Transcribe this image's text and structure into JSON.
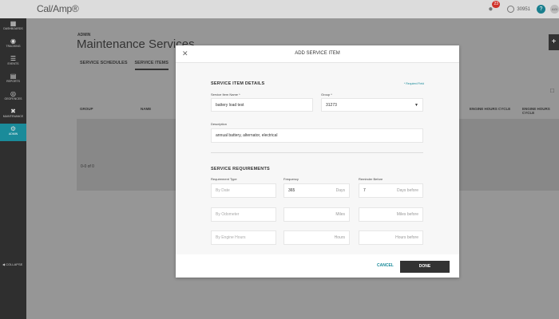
{
  "topbar": {
    "logo": "Cal/Amp®",
    "notification_count": "23",
    "user_id": "30951",
    "help": "?",
    "avatar_text": "AGI"
  },
  "sidebar": {
    "items": [
      {
        "label": "DASHBOARDS",
        "icon": "dashboard-icon"
      },
      {
        "label": "TRACKING",
        "icon": "tracking-icon"
      },
      {
        "label": "EVENTS",
        "icon": "events-icon"
      },
      {
        "label": "REPORTS",
        "icon": "reports-icon"
      },
      {
        "label": "GEOFENCES",
        "icon": "geofence-icon"
      },
      {
        "label": "MAINTENANCE",
        "icon": "maintenance-icon"
      },
      {
        "label": "ADMIN",
        "icon": "admin-icon"
      }
    ],
    "collapse_label": "COLLAPSE"
  },
  "page": {
    "breadcrumb": "ADMIN",
    "title": "Maintenance Services",
    "tabs": [
      "SERVICE SCHEDULES",
      "SERVICE ITEMS"
    ],
    "columns": [
      "GROUP",
      "NAME",
      "ENGINE HOURS CYCLE",
      "ENGINE HOURS CYCLE"
    ],
    "pager": "0-0 of 0"
  },
  "modal": {
    "title": "ADD SERVICE ITEM",
    "details_title": "SERVICE ITEM DETAILS",
    "required_note": "* Required Field",
    "name_label": "Service Item Name *",
    "name_value": "battery load test",
    "group_label": "Group *",
    "group_value": "31273",
    "desc_label": "Description",
    "desc_value": "annual battery, alternator, electrical",
    "req_title": "SERVICE REQUIREMENTS",
    "col_type": "Requirement Type",
    "col_freq": "Frequency",
    "col_reminder": "Reminder Before",
    "rows": [
      {
        "type": "By Date",
        "freq": "365",
        "freq_unit": "Days",
        "rem": "7",
        "rem_unit": "Days before"
      },
      {
        "type": "By Odometer",
        "freq": "",
        "freq_unit": "Miles",
        "rem": "",
        "rem_unit": "Miles before"
      },
      {
        "type": "By Engine Hours",
        "freq": "",
        "freq_unit": "Hours",
        "rem": "",
        "rem_unit": "Hours before"
      }
    ],
    "cancel": "CANCEL",
    "done": "DONE"
  }
}
